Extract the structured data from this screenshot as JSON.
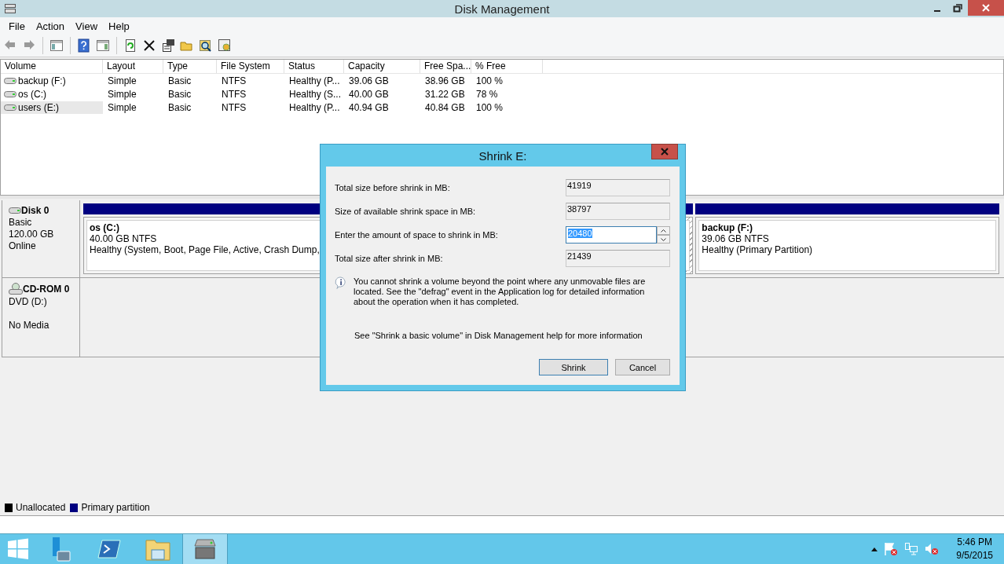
{
  "window": {
    "title": "Disk Management"
  },
  "menu": [
    "File",
    "Action",
    "View",
    "Help"
  ],
  "volume_table": {
    "columns": [
      "Volume",
      "Layout",
      "Type",
      "File System",
      "Status",
      "Capacity",
      "Free Spa...",
      "% Free"
    ],
    "rows": [
      {
        "cells": [
          "backup (F:)",
          "Simple",
          "Basic",
          "NTFS",
          "Healthy (P...",
          "39.06 GB",
          "38.96 GB",
          "100 %"
        ],
        "selected": false
      },
      {
        "cells": [
          "os (C:)",
          "Simple",
          "Basic",
          "NTFS",
          "Healthy (S...",
          "40.00 GB",
          "31.22 GB",
          "78 %"
        ],
        "selected": false
      },
      {
        "cells": [
          "users (E:)",
          "Simple",
          "Basic",
          "NTFS",
          "Healthy (P...",
          "40.94 GB",
          "40.84 GB",
          "100 %"
        ],
        "selected": true
      }
    ]
  },
  "disks": [
    {
      "kind": "disk",
      "name": "Disk 0",
      "type": "Basic",
      "size": "120.00 GB",
      "status": "Online",
      "partitions": [
        {
          "name": "os  (C:)",
          "size": "40.00 GB NTFS",
          "status": "Healthy (System, Boot, Page File, Active, Crash Dump,",
          "selected": false
        },
        {
          "selected": true
        },
        {
          "name": "backup  (F:)",
          "size": "39.06 GB NTFS",
          "status": "Healthy (Primary Partition)",
          "selected": false
        }
      ]
    },
    {
      "kind": "cdrom",
      "name": "CD-ROM 0",
      "type": "DVD (D:)",
      "status": "No Media"
    }
  ],
  "legend": [
    {
      "label": "Unallocated",
      "color": "#000000"
    },
    {
      "label": "Primary partition",
      "color": "#000080"
    }
  ],
  "dialog": {
    "title": "Shrink E:",
    "fields": [
      {
        "kind": "readonly",
        "label": "Total size before shrink in MB:",
        "value": "41919"
      },
      {
        "kind": "readonly",
        "label": "Size of available shrink space in MB:",
        "value": "38797"
      },
      {
        "kind": "spin",
        "label": "Enter the amount of space to shrink in MB:",
        "value": "20480"
      },
      {
        "kind": "readonly",
        "label": "Total size after shrink in MB:",
        "value": "21439"
      }
    ],
    "info": "You cannot shrink a volume beyond the point where any unmovable files are located. See the \"defrag\" event in the Application log for detailed information about the operation when it has completed.",
    "help": "See \"Shrink a basic volume\" in Disk Management help for more information",
    "buttons": [
      {
        "label": "Shrink",
        "default": true
      },
      {
        "label": "Cancel",
        "default": false
      }
    ]
  },
  "taskbar": {
    "apps": [
      {
        "kind": "server-manager",
        "selected": false
      },
      {
        "kind": "powershell",
        "selected": false
      },
      {
        "kind": "explorer",
        "selected": false
      },
      {
        "kind": "disk-management",
        "selected": true
      }
    ],
    "time": "5:46 PM",
    "date": "9/5/2015"
  }
}
